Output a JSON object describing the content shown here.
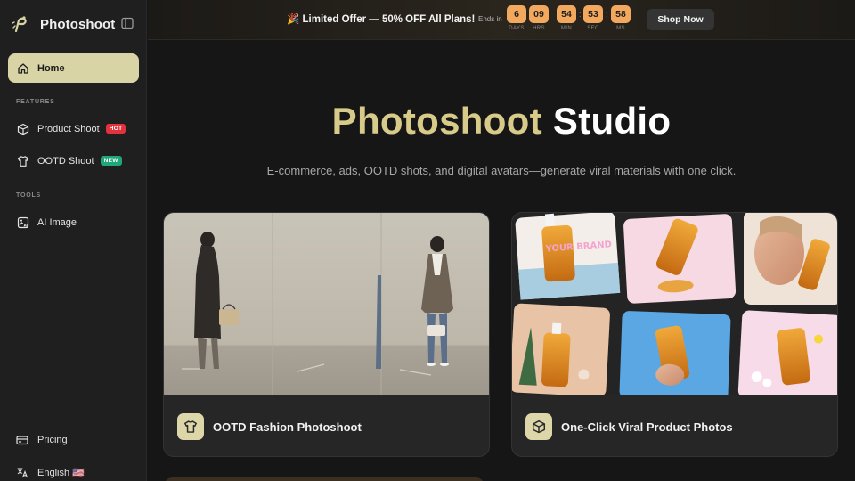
{
  "brand": {
    "name": "Photoshoot"
  },
  "sidebar": {
    "home": "Home",
    "features_label": "FEATURES",
    "product_shoot": {
      "label": "Product Shoot",
      "badge": "HOT"
    },
    "ootd_shoot": {
      "label": "OOTD Shoot",
      "badge": "NEW"
    },
    "tools_label": "TOOLS",
    "ai_image": "AI Image",
    "pricing": "Pricing",
    "language": "English 🇺🇸"
  },
  "banner": {
    "offer": "🎉 Limited Offer — 50% OFF All Plans!",
    "ends_in": "Ends in",
    "countdown": [
      {
        "value": "6",
        "unit": "DAYS"
      },
      {
        "value": "09",
        "unit": "HRS"
      },
      {
        "value": "54",
        "unit": "MIN"
      },
      {
        "value": "53",
        "unit": "SEC"
      },
      {
        "value": "58",
        "unit": "MS"
      }
    ],
    "cta": "Shop Now"
  },
  "hero": {
    "title_gold": "Photoshoot",
    "title_white": "Studio",
    "subtitle": "E-commerce, ads, OOTD shots, and digital avatars—generate viral materials with one click."
  },
  "cards": [
    {
      "label": "OOTD Fashion Photoshoot",
      "icon": "shirt-icon"
    },
    {
      "label": "One-Click Viral Product Photos",
      "icon": "box-icon"
    }
  ],
  "product_tile_text": "YOUR BRAND",
  "colors": {
    "accent": "#d8d4a6",
    "hero_gold": "#d8cb8a",
    "countdown": "#f2a95e",
    "hot": "#e2323d",
    "new": "#1fa67a"
  }
}
